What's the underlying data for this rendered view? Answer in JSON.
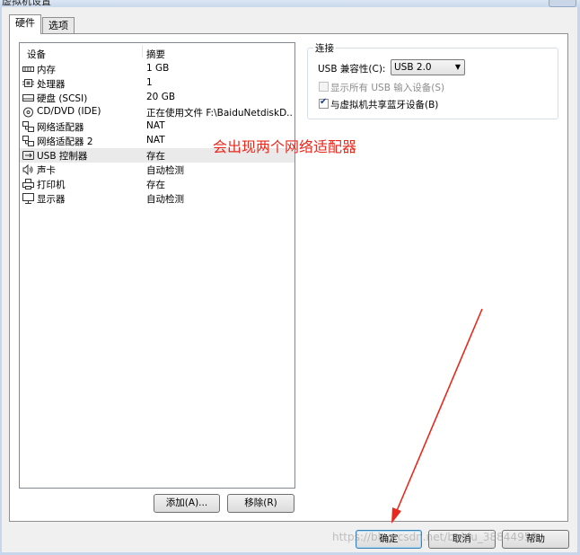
{
  "window": {
    "title": "虚拟机设置"
  },
  "tabs": [
    {
      "label": "硬件"
    },
    {
      "label": "选项"
    }
  ],
  "device_list": {
    "columns": {
      "device": "设备",
      "summary": "摘要"
    },
    "rows": [
      {
        "icon": "memory-icon",
        "name": "内存",
        "summary": "1 GB"
      },
      {
        "icon": "processor-icon",
        "name": "处理器",
        "summary": "1"
      },
      {
        "icon": "hard-disk-icon",
        "name": "硬盘 (SCSI)",
        "summary": "20 GB"
      },
      {
        "icon": "cd-dvd-icon",
        "name": "CD/DVD (IDE)",
        "summary": "正在使用文件 F:\\BaiduNetdiskD..."
      },
      {
        "icon": "network-adapter-icon",
        "name": "网络适配器",
        "summary": "NAT"
      },
      {
        "icon": "network-adapter-icon",
        "name": "网络适配器 2",
        "summary": "NAT"
      },
      {
        "icon": "usb-icon",
        "name": "USB 控制器",
        "summary": "存在"
      },
      {
        "icon": "sound-card-icon",
        "name": "声卡",
        "summary": "自动检测"
      },
      {
        "icon": "printer-icon",
        "name": "打印机",
        "summary": "存在"
      },
      {
        "icon": "display-icon",
        "name": "显示器",
        "summary": "自动检测"
      }
    ],
    "selected_index": 6
  },
  "list_buttons": {
    "add": "添加(A)...",
    "remove": "移除(R)"
  },
  "connection": {
    "legend": "连接",
    "usb_compat_label": "USB 兼容性(C):",
    "usb_compat_value": "USB 2.0",
    "show_all_usb": {
      "label": "显示所有 USB 输入设备(S)",
      "checked": false,
      "disabled": true
    },
    "share_bluetooth": {
      "label": "与虚拟机共享蓝牙设备(B)",
      "checked": true
    }
  },
  "annotation": {
    "text": "会出现两个网络适配器",
    "color": "#e8291c"
  },
  "dialog_buttons": {
    "ok": "确定",
    "cancel": "取消",
    "help": "帮助"
  },
  "watermark": "https://blog.csdn.net/baidu_38844953"
}
